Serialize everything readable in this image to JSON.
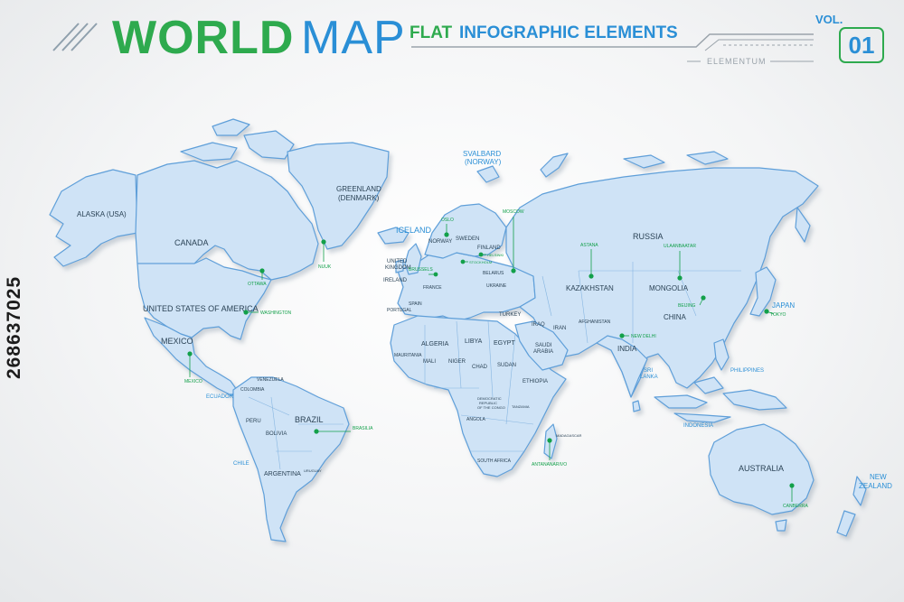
{
  "header": {
    "title_world": "WORLD",
    "title_map": "MAP",
    "subtitle_flat": "FLAT",
    "subtitle_info": "INFOGRAPHIC ELEMENTS",
    "brand": "ELEMENTUM",
    "vol_label": "VOL.",
    "vol_number": "01"
  },
  "watermark": "268637025",
  "colors": {
    "green": "#2eaa4e",
    "blue": "#2a8fd6",
    "land_fill": "#cfe3f6",
    "land_stroke": "#5f9fd9",
    "capital_green": "#13a04a"
  },
  "labels": {
    "alaska": "ALASKA (USA)",
    "canada": "CANADA",
    "usa": "UNITED STATES OF AMERICA",
    "mexico": "MEXICO",
    "greenland1": "GREENLAND",
    "greenland2": "(DENMARK)",
    "svalbard1": "SVALBARD",
    "svalbard2": "(NORWAY)",
    "iceland": "ICELAND",
    "uk1": "UNITED",
    "uk2": "KINGDOM",
    "ireland": "IRELAND",
    "norway": "NORWAY",
    "sweden": "SWEDEN",
    "finland": "FINLAND",
    "russia": "RUSSIA",
    "kazakhstan": "KAZAKHSTAN",
    "mongolia": "MONGOLIA",
    "china": "CHINA",
    "japan": "JAPAN",
    "turkey": "TURKEY",
    "iran": "IRAN",
    "iraq": "IRAQ",
    "saudi1": "SAUDI",
    "saudi2": "ARABIA",
    "india": "INDIA",
    "srilanka1": "SRI",
    "srilanka2": "LANKA",
    "philippines": "PHILIPPINES",
    "indonesia": "INDONESIA",
    "australia": "AUSTRALIA",
    "newzealand1": "NEW",
    "newzealand2": "ZEALAND",
    "algeria": "ALGERIA",
    "libya": "LIBYA",
    "egypt": "EGYPT",
    "mali": "MALI",
    "niger": "NIGER",
    "chad": "CHAD",
    "sudan": "SUDAN",
    "ethiopia": "ETHIOPIA",
    "madagascar": "MADAGASCAR",
    "southafrica": "SOUTH AFRICA",
    "drc1": "DEMOCRATIC",
    "drc2": "REPUBLIC",
    "drc3": "OF THE CONGO",
    "brazil": "BRAZIL",
    "peru": "PERU",
    "bolivia": "BOLIVIA",
    "chile": "CHILE",
    "argentina": "ARGENTINA",
    "colombia": "COLOMBIA",
    "venezuela": "VENEZUELA",
    "ecuador": "ECUADOR",
    "portugal": "PORTUGAL",
    "spain": "SPAIN",
    "france": "FRANCE",
    "belarus": "BELARUS",
    "ukraine": "UKRAINE",
    "afghanistan": "AFGHANISTAN",
    "mauritania": "MAURITANIA",
    "tanzania": "TANZANIA",
    "angola": "ANGOLA",
    "uruguay": "URUGUAY"
  },
  "capitals": {
    "ottawa": "OTTAWA",
    "washington": "WASHINGTON",
    "mexico_city": "MEXICO",
    "brasilia": "BRASILIA",
    "nuuk": "NUUK",
    "oslo": "OSLO",
    "stockholm": "STOCKHOLM",
    "helsinki": "HELSINKI",
    "moscow": "MOSCOW",
    "brussels": "BRUSSELS",
    "astana": "ASTANA",
    "ulaanbaatar": "ULAANBAATAR",
    "beijing": "BEIJING",
    "tokyo": "TOKYO",
    "new_delhi": "NEW DELHI",
    "antananarivo": "ANTANANARIVO",
    "canberra": "CANBERRA"
  }
}
